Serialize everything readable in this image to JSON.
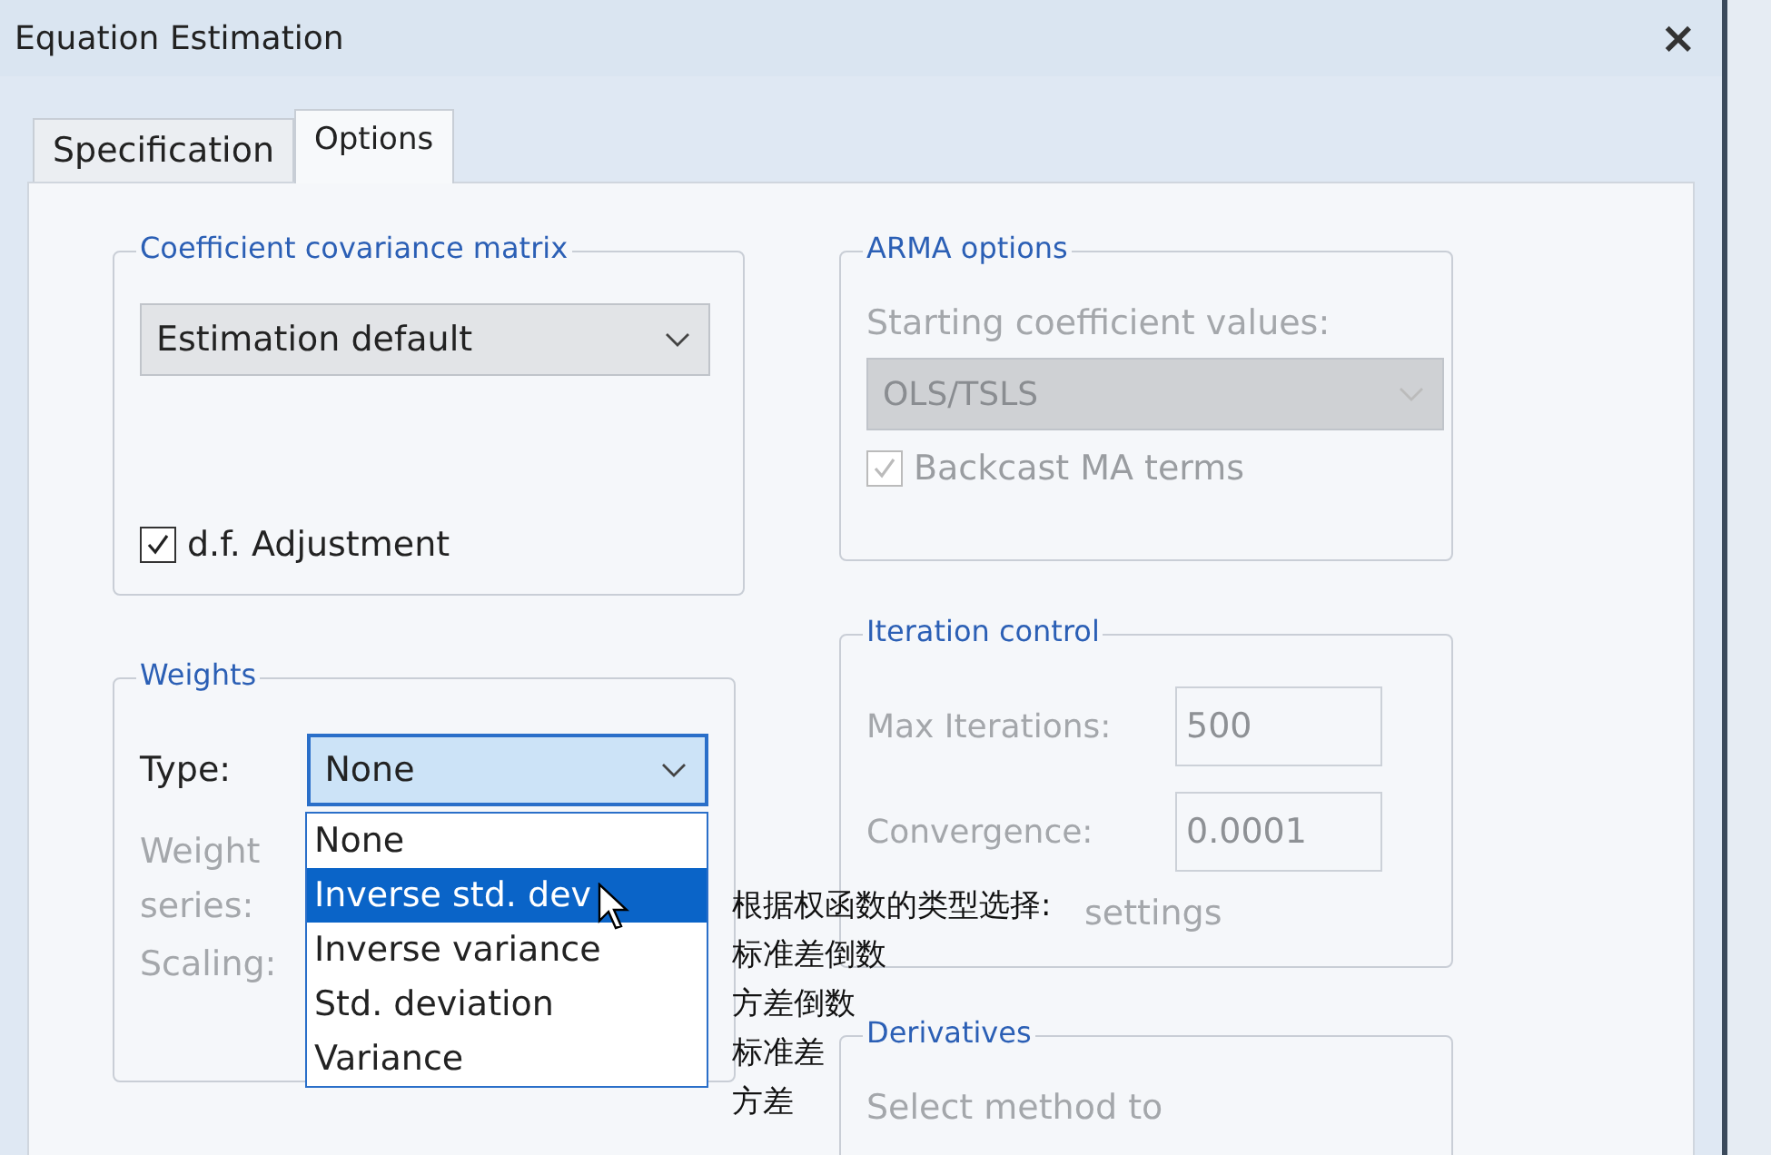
{
  "window": {
    "title": "Equation Estimation",
    "close": "×"
  },
  "tabs": [
    {
      "label": "Specification",
      "selected": false
    },
    {
      "label": "Options",
      "selected": true
    }
  ],
  "covariance": {
    "title": "Coefficient covariance matrix",
    "value": "Estimation default",
    "df_adjustment": {
      "label": "d.f. Adjustment",
      "checked": true
    }
  },
  "arma": {
    "title": "ARMA options",
    "starting_label": "Starting coefficient values:",
    "starting_value": "OLS/TSLS",
    "backcast": {
      "label": "Backcast MA terms",
      "checked": true
    }
  },
  "weights": {
    "title": "Weights",
    "type_label": "Type:",
    "type_value": "None",
    "weight_series_label": "Weight series:",
    "scaling_label": "Scaling:",
    "options": [
      {
        "label": "None",
        "selected": false
      },
      {
        "label": "Inverse std. dev",
        "selected": true
      },
      {
        "label": "Inverse variance",
        "selected": false
      },
      {
        "label": "Std. deviation",
        "selected": false
      },
      {
        "label": "Variance",
        "selected": false
      }
    ]
  },
  "iteration": {
    "title": "Iteration control",
    "max_label": "Max Iterations:",
    "max_value": "500",
    "conv_label": "Convergence:",
    "conv_value": "0.0001",
    "settings_label": "settings"
  },
  "derivatives": {
    "title": "Derivatives",
    "text": "Select method to"
  },
  "annotation": [
    "根据权函数的类型选择:",
    "标准差倒数",
    "方差倒数",
    "标准差",
    "方差"
  ]
}
